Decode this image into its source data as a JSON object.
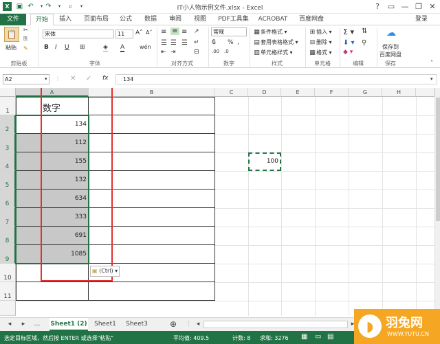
{
  "title": "IT小人物示例文件.xlsx - Excel",
  "window": {
    "help": "?",
    "minimize": "—",
    "restore": "❐",
    "close": "✕",
    "login": "登录"
  },
  "tabs": [
    "文件",
    "开始",
    "插入",
    "页面布局",
    "公式",
    "数据",
    "审阅",
    "视图",
    "PDF工具集",
    "ACROBAT",
    "百度网盘"
  ],
  "ribbon": {
    "paste": "粘贴",
    "font_name": "宋体",
    "font_size": "11",
    "number_format": "常规",
    "conditional": "条件格式",
    "table_format": "套用表格格式",
    "cell_style": "单元格样式",
    "insert": "插入",
    "delete": "删除",
    "format": "格式",
    "save_baidu_1": "保存到",
    "save_baidu_2": "百度网盘",
    "groups": [
      "剪贴板",
      "字体",
      "对齐方式",
      "数字",
      "样式",
      "单元格",
      "编辑",
      "保存"
    ]
  },
  "formula": {
    "namebox": "A2",
    "fx": "fx",
    "value": "134"
  },
  "columns": [
    "A",
    "B",
    "C",
    "D",
    "E",
    "F",
    "G",
    "H"
  ],
  "rows": [
    "1",
    "2",
    "3",
    "4",
    "5",
    "6",
    "7",
    "8",
    "9",
    "10",
    "11"
  ],
  "cells": {
    "a1": "数字",
    "a_values": [
      "134",
      "112",
      "155",
      "132",
      "634",
      "333",
      "691",
      "1085"
    ],
    "d4": "100"
  },
  "paste_options": "(Ctrl)",
  "sheets": [
    "Sheet1 (2)",
    "Sheet1",
    "Sheet3"
  ],
  "status": {
    "message": "选定目标区域，然后按 ENTER 或选择\"粘贴\"",
    "average": "平均值: 409.5",
    "count": "计数: 8",
    "sum": "求和: 3276"
  },
  "watermark": {
    "name": "羽兔网",
    "url": "WWW.YUTU.CN"
  },
  "colors": {
    "excel_green": "#217346",
    "selection": "#c8c8c8",
    "red_box": "#e03030"
  }
}
